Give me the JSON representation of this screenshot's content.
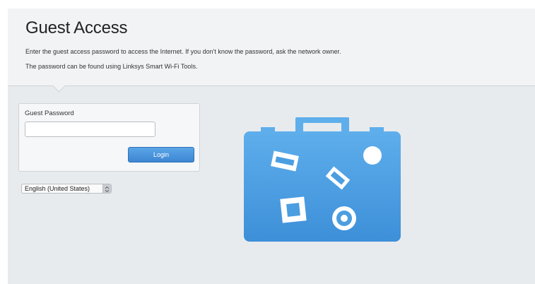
{
  "header": {
    "title": "Guest Access",
    "description_line1": "Enter the guest access password to access the Internet. If you don't know the password, ask the network owner.",
    "description_line2": "The password can be found using Linksys Smart Wi-Fi Tools."
  },
  "login": {
    "password_label": "Guest Password",
    "password_value": "",
    "login_button_label": "Login"
  },
  "language": {
    "selected": "English (United States)"
  },
  "illustration": {
    "icon": "suitcase-icon",
    "color": "#4b9ee0"
  }
}
